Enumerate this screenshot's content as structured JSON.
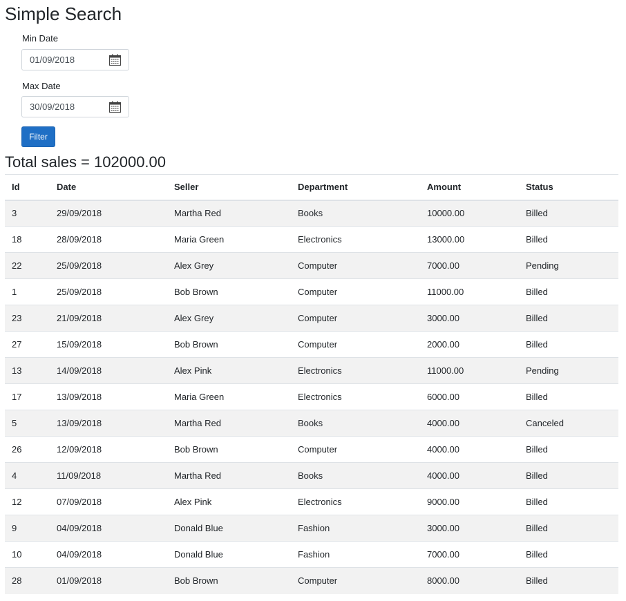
{
  "page": {
    "title": "Simple Search"
  },
  "filters": {
    "min_date": {
      "label": "Min Date",
      "value": "01/09/2018"
    },
    "max_date": {
      "label": "Max Date",
      "value": "30/09/2018"
    },
    "filter_button": "Filter"
  },
  "summary": {
    "total_sales": "Total sales = 102000.00"
  },
  "table": {
    "headers": [
      "Id",
      "Date",
      "Seller",
      "Department",
      "Amount",
      "Status"
    ],
    "rows": [
      [
        "3",
        "29/09/2018",
        "Martha Red",
        "Books",
        "10000.00",
        "Billed"
      ],
      [
        "18",
        "28/09/2018",
        "Maria Green",
        "Electronics",
        "13000.00",
        "Billed"
      ],
      [
        "22",
        "25/09/2018",
        "Alex Grey",
        "Computer",
        "7000.00",
        "Pending"
      ],
      [
        "1",
        "25/09/2018",
        "Bob Brown",
        "Computer",
        "11000.00",
        "Billed"
      ],
      [
        "23",
        "21/09/2018",
        "Alex Grey",
        "Computer",
        "3000.00",
        "Billed"
      ],
      [
        "27",
        "15/09/2018",
        "Bob Brown",
        "Computer",
        "2000.00",
        "Billed"
      ],
      [
        "13",
        "14/09/2018",
        "Alex Pink",
        "Electronics",
        "11000.00",
        "Pending"
      ],
      [
        "17",
        "13/09/2018",
        "Maria Green",
        "Electronics",
        "6000.00",
        "Billed"
      ],
      [
        "5",
        "13/09/2018",
        "Martha Red",
        "Books",
        "4000.00",
        "Canceled"
      ],
      [
        "26",
        "12/09/2018",
        "Bob Brown",
        "Computer",
        "4000.00",
        "Billed"
      ],
      [
        "4",
        "11/09/2018",
        "Martha Red",
        "Books",
        "4000.00",
        "Billed"
      ],
      [
        "12",
        "07/09/2018",
        "Alex Pink",
        "Electronics",
        "9000.00",
        "Billed"
      ],
      [
        "9",
        "04/09/2018",
        "Donald Blue",
        "Fashion",
        "3000.00",
        "Billed"
      ],
      [
        "10",
        "04/09/2018",
        "Donald Blue",
        "Fashion",
        "7000.00",
        "Billed"
      ],
      [
        "28",
        "01/09/2018",
        "Bob Brown",
        "Computer",
        "8000.00",
        "Billed"
      ]
    ]
  },
  "icons": {
    "date_picker": "calendar-icon"
  },
  "colors": {
    "primary_button": "#1f6fc5",
    "striped_row": "#f2f2f2",
    "text": "#212529"
  }
}
